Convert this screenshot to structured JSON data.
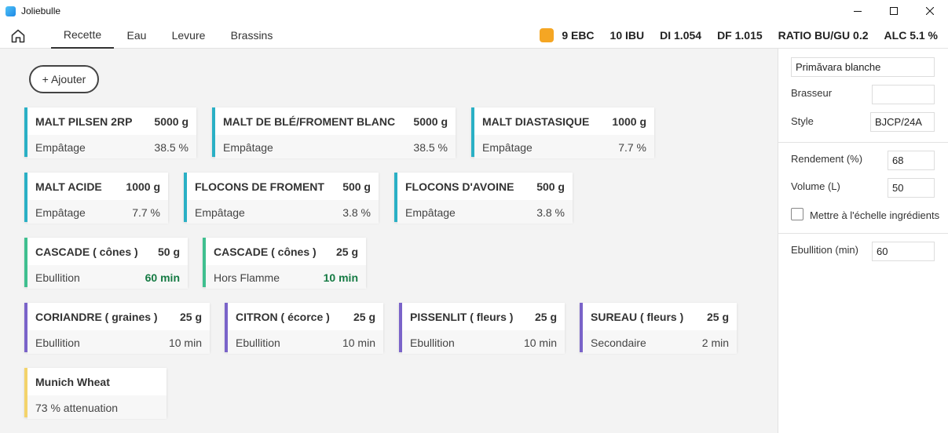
{
  "window": {
    "title": "Joliebulle"
  },
  "nav": {
    "tabs": [
      "Recette",
      "Eau",
      "Levure",
      "Brassins"
    ],
    "active_tab": "Recette"
  },
  "stats": {
    "ebc": "9 EBC",
    "ibu": "10 IBU",
    "di": "DI 1.054",
    "df": "DF 1.015",
    "ratio": "RATIO BU/GU 0.2",
    "alc": "ALC 5.1 %",
    "ebc_color": "#f5a623"
  },
  "main": {
    "add_button": "+ Ajouter",
    "ingredients": [
      {
        "name": "MALT PILSEN 2RP",
        "amount": "5000 g",
        "step": "Empâtage",
        "value": "38.5 %",
        "kind": "malt"
      },
      {
        "name": "MALT DE BLÉ/FROMENT BLANC",
        "amount": "5000 g",
        "step": "Empâtage",
        "value": "38.5 %",
        "kind": "malt"
      },
      {
        "name": "MALT DIASTASIQUE",
        "amount": "1000 g",
        "step": "Empâtage",
        "value": "7.7 %",
        "kind": "malt"
      },
      {
        "name": "MALT ACIDE",
        "amount": "1000 g",
        "step": "Empâtage",
        "value": "7.7 %",
        "kind": "malt"
      },
      {
        "name": "FLOCONS DE FROMENT",
        "amount": "500 g",
        "step": "Empâtage",
        "value": "3.8 %",
        "kind": "malt"
      },
      {
        "name": "FLOCONS D'AVOINE",
        "amount": "500 g",
        "step": "Empâtage",
        "value": "3.8 %",
        "kind": "malt"
      },
      {
        "name": "CASCADE ( cônes )",
        "amount": "50 g",
        "step": "Ebullition",
        "value": "60 min",
        "kind": "hop"
      },
      {
        "name": "CASCADE ( cônes )",
        "amount": "25 g",
        "step": "Hors Flamme",
        "value": "10 min",
        "kind": "hop"
      },
      {
        "name": "CORIANDRE ( graines )",
        "amount": "25 g",
        "step": "Ebullition",
        "value": "10 min",
        "kind": "misc"
      },
      {
        "name": "CITRON ( écorce )",
        "amount": "25 g",
        "step": "Ebullition",
        "value": "10 min",
        "kind": "misc"
      },
      {
        "name": "PISSENLIT ( fleurs )",
        "amount": "25 g",
        "step": "Ebullition",
        "value": "10 min",
        "kind": "misc"
      },
      {
        "name": "SUREAU ( fleurs )",
        "amount": "25 g",
        "step": "Secondaire",
        "value": "2 min",
        "kind": "misc"
      },
      {
        "name": "Munich Wheat",
        "amount": "",
        "step": "73 % attenuation",
        "value": "",
        "kind": "yeast"
      }
    ],
    "colors": {
      "malt": "#2ab0c5",
      "hop": "#3fbf8f",
      "misc": "#7a63c9",
      "yeast": "#f3d36b",
      "hop_time": "#157a43"
    }
  },
  "sidebar": {
    "recipe_name": "Primăvara blanche",
    "brewer_label": "Brasseur",
    "brewer_value": "",
    "style_label": "Style",
    "style_value": "BJCP/24A",
    "efficiency_label": "Rendement (%)",
    "efficiency_value": "68",
    "volume_label": "Volume (L)",
    "volume_value": "50",
    "scale_label": "Mettre à l'échelle ingrédients",
    "scale_checked": false,
    "boil_label": "Ebullition (min)",
    "boil_value": "60"
  }
}
